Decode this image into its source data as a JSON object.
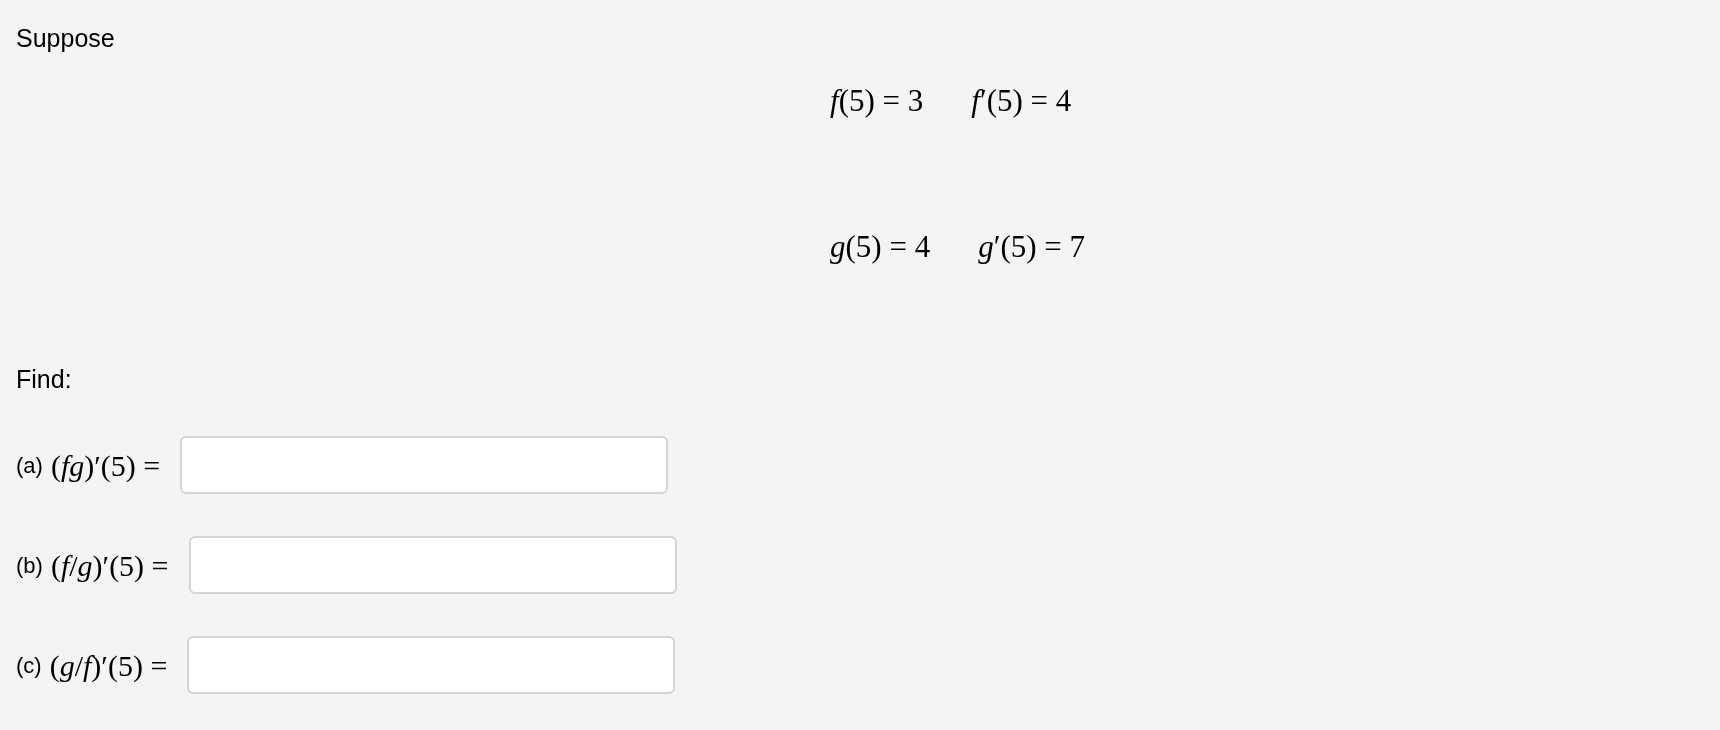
{
  "intro": "Suppose",
  "givens": [
    [
      "*f*(5) = 3",
      "*f*′(5) = 4"
    ],
    [
      "*g*(5) = 4",
      "*g*′(5) = 7"
    ]
  ],
  "find": "Find:",
  "questions": [
    {
      "label": "(a)",
      "expression": "(*fg*)′(5) ="
    },
    {
      "label": "(b)",
      "expression": "(*f*/*g*)′(5) ="
    },
    {
      "label": "(c)",
      "expression": "(*g*/*f*)′(5) ="
    }
  ]
}
